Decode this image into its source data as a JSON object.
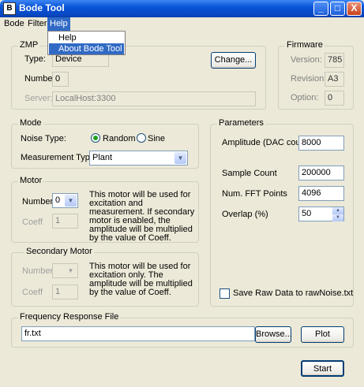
{
  "window": {
    "title": "Bode Tool",
    "app_icon_text": "B",
    "minimize": "_",
    "maximize": "□",
    "close": "X"
  },
  "menubar": {
    "bode": "Bode",
    "filter": "Filter",
    "help": "Help"
  },
  "help_menu": {
    "items": [
      "Help",
      "About Bode Tool"
    ]
  },
  "zmp": {
    "legend": "ZMP",
    "type_label": "Type:",
    "type_value": "Device",
    "number_label": "Number:",
    "number_value": "0",
    "server_label": "Server:",
    "server_value": "LocalHost:3300",
    "change_button": "Change..."
  },
  "firmware": {
    "legend": "Firmware",
    "version_label": "Version:",
    "version_value": "785",
    "revision_label": "Revision:",
    "revision_value": "A3",
    "option_label": "Option:",
    "option_value": "0"
  },
  "mode": {
    "legend": "Mode",
    "noise_type_label": "Noise Type:",
    "noise_options": [
      "Random",
      "Sine"
    ],
    "noise_selected": "Random",
    "measurement_type_label": "Measurement Type:",
    "measurement_type_value": "Plant"
  },
  "motor": {
    "legend": "Motor",
    "number_label": "Number",
    "number_value": "0",
    "coeff_label": "Coeff",
    "coeff_value": "1",
    "description": "This motor will be used for excitation and measurement. If secondary motor is enabled, the amplitude will be multiplied by the value of Coeff."
  },
  "secondary_motor": {
    "legend": "Secondary Motor",
    "number_label": "Number",
    "number_value": "",
    "coeff_label": "Coeff",
    "coeff_value": "1",
    "description": "This motor will be used for excitation only. The amplitude will be multiplied by the value of Coeff."
  },
  "parameters": {
    "legend": "Parameters",
    "amplitude_label": "Amplitude (DAC counts)",
    "amplitude_value": "8000",
    "sample_count_label": "Sample Count",
    "sample_count_value": "200000",
    "fft_points_label": "Num. FFT Points",
    "fft_points_value": "4096",
    "overlap_label": "Overlap (%)",
    "overlap_value": "50",
    "save_raw_label": "Save Raw Data to rawNoise.txt",
    "save_raw_checked": false
  },
  "frequency_response": {
    "legend": "Frequency Response File",
    "file_value": "fr.txt",
    "browse_button": "Browse...",
    "plot_button": "Plot"
  },
  "start_button": "Start"
}
